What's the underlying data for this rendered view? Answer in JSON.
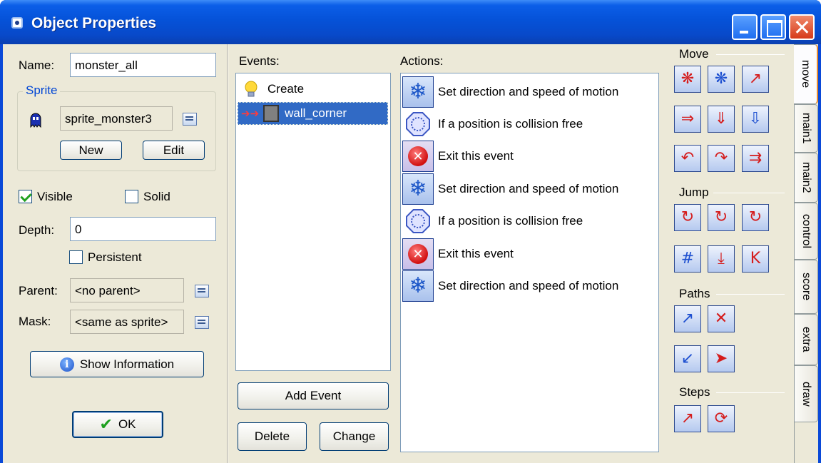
{
  "window": {
    "title": "Object Properties"
  },
  "left": {
    "name_label": "Name:",
    "name_value": "monster_all",
    "sprite_group": "Sprite",
    "sprite_value": "sprite_monster3",
    "new_label": "New",
    "edit_label": "Edit",
    "visible_label": "Visible",
    "visible_checked": true,
    "solid_label": "Solid",
    "solid_checked": false,
    "depth_label": "Depth:",
    "depth_value": "0",
    "persistent_label": "Persistent",
    "persistent_checked": false,
    "parent_label": "Parent:",
    "parent_value": "<no parent>",
    "mask_label": "Mask:",
    "mask_value": "<same as sprite>",
    "show_info_label": "Show Information",
    "ok_label": "OK"
  },
  "events": {
    "label": "Events:",
    "items": [
      {
        "label": "Create",
        "icon": "lightbulb-icon",
        "selected": false
      },
      {
        "label": "wall_corner",
        "icon": "collision-icon",
        "selected": true
      }
    ],
    "add_label": "Add Event",
    "delete_label": "Delete",
    "change_label": "Change"
  },
  "actions": {
    "label": "Actions:",
    "items": [
      {
        "label": "Set direction and speed of motion",
        "icon": "move-fixed-icon"
      },
      {
        "label": "If a position is collision free",
        "icon": "collision-free-icon"
      },
      {
        "label": "Exit this event",
        "icon": "exit-event-icon"
      },
      {
        "label": "Set direction and speed of motion",
        "icon": "move-fixed-icon"
      },
      {
        "label": "If a position is collision free",
        "icon": "collision-free-icon"
      },
      {
        "label": "Exit this event",
        "icon": "exit-event-icon"
      },
      {
        "label": "Set direction and speed of motion",
        "icon": "move-fixed-icon"
      }
    ]
  },
  "palette": {
    "sections": {
      "move": "Move",
      "jump": "Jump",
      "paths": "Paths",
      "steps": "Steps"
    }
  },
  "tabs": [
    "move",
    "main1",
    "main2",
    "control",
    "score",
    "extra",
    "draw"
  ],
  "active_tab": "move"
}
